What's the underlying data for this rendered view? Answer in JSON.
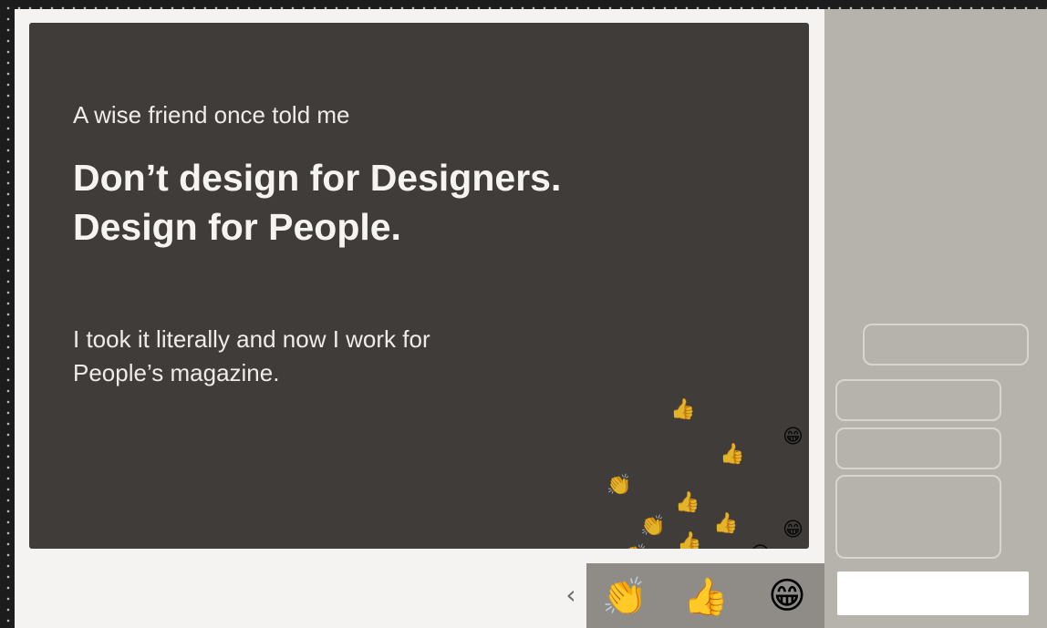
{
  "slide": {
    "intro": "A wise friend once told me",
    "headline_line1": "Don’t design for Designers.",
    "headline_line2": "Design for People.",
    "body_line1": "I took it literally and now I work for",
    "body_line2": "People’s magazine."
  },
  "floating_reactions": [
    "👍",
    "👍",
    "😁",
    "👏",
    "👍",
    "👏",
    "👍",
    "😁",
    "👍",
    "👏",
    "😁"
  ],
  "reactions": {
    "clap": "👏",
    "thumbs_up": "👍",
    "grin": "😁",
    "prev": "‹"
  },
  "colors": {
    "slide_bg": "#403c3a",
    "side_panel": "#b6b3ad",
    "reaction_bar": "#8f8c88"
  }
}
